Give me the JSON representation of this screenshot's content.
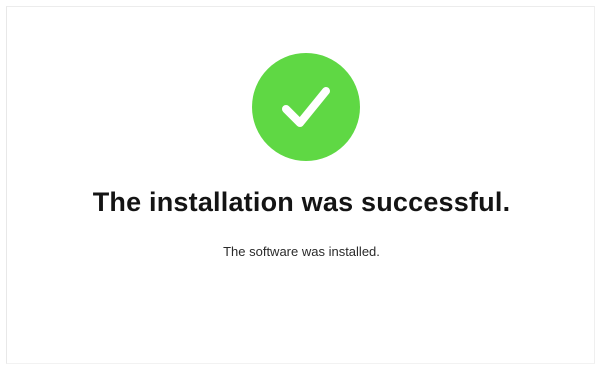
{
  "window": {
    "status": "success"
  },
  "icon": {
    "name": "checkmark-circle-icon",
    "color": "#5fd844",
    "glyph_color": "#ffffff"
  },
  "message": {
    "title": "The installation was successful.",
    "detail": "The software was installed."
  }
}
